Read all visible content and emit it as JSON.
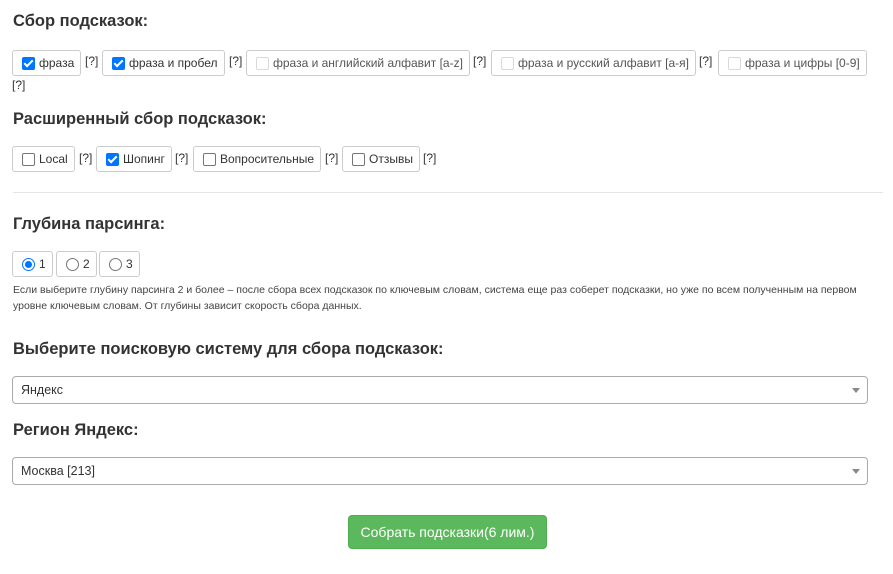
{
  "hints": {
    "title": "Сбор подсказок:",
    "options": [
      {
        "label": "фраза",
        "checked": true,
        "disabled": false
      },
      {
        "label": "фраза и пробел",
        "checked": true,
        "disabled": false
      },
      {
        "label": "фраза и английский алфавит [a-z]",
        "checked": false,
        "disabled": true
      },
      {
        "label": "фраза и русский алфавит [а-я]",
        "checked": false,
        "disabled": true
      },
      {
        "label": "фраза и цифры [0-9]",
        "checked": false,
        "disabled": true
      }
    ],
    "help_mark": "[?]"
  },
  "extended": {
    "title": "Расширенный сбор подсказок:",
    "options": [
      {
        "label": "Local",
        "checked": false
      },
      {
        "label": "Шопинг",
        "checked": true
      },
      {
        "label": "Вопросительные",
        "checked": false
      },
      {
        "label": "Отзывы",
        "checked": false
      }
    ]
  },
  "depth": {
    "title": "Глубина парсинга:",
    "options": [
      "1",
      "2",
      "3"
    ],
    "selected": "1",
    "help_text": "Если выберите глубину парсинга 2 и более – после сбора всех подсказок по ключевым словам, система еще раз соберет подсказки, но уже по всем полученным на первом уровне ключевым словам. От глубины зависит скорость сбора данных."
  },
  "engine": {
    "title": "Выберите поисковую систему для сбора подсказок:",
    "value": "Яндекс"
  },
  "region": {
    "title": "Регион Яндекс:",
    "value": "Москва [213]"
  },
  "submit_label": "Собрать подсказки(6 лим.)",
  "colors": {
    "accent": "#0075ff",
    "button": "#5cb85c"
  }
}
